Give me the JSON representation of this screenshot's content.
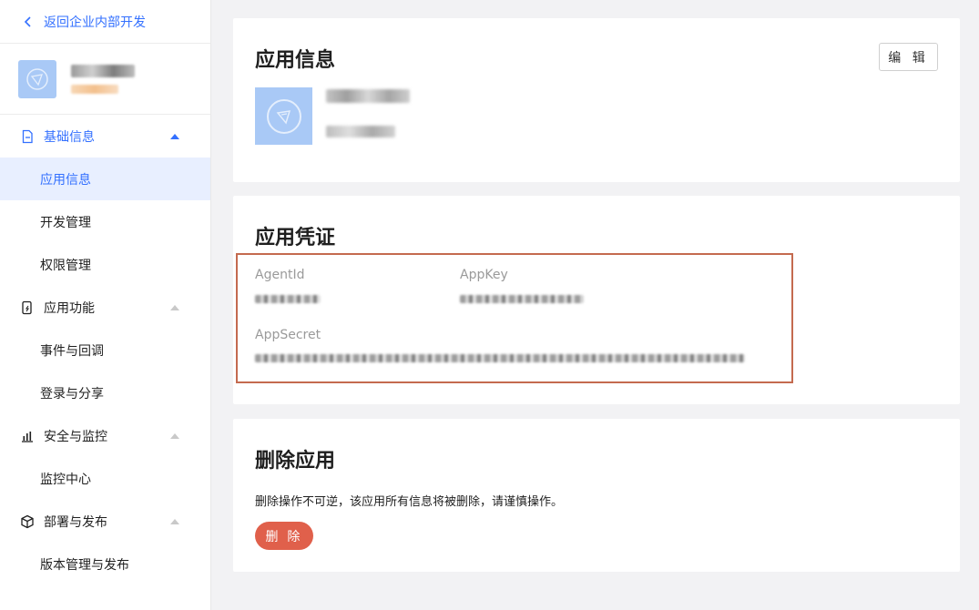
{
  "sidebar": {
    "back_label": "返回企业内部开发",
    "groups": [
      {
        "label": "基础信息",
        "items": [
          "应用信息",
          "开发管理",
          "权限管理"
        ]
      },
      {
        "label": "应用功能",
        "items": [
          "事件与回调",
          "登录与分享"
        ]
      },
      {
        "label": "安全与监控",
        "items": [
          "监控中心"
        ]
      },
      {
        "label": "部署与发布",
        "items": [
          "版本管理与发布"
        ]
      }
    ]
  },
  "info_card": {
    "title": "应用信息",
    "edit_label": "编 辑"
  },
  "cred_card": {
    "title": "应用凭证",
    "agentid_label": "AgentId",
    "appkey_label": "AppKey",
    "appsecret_label": "AppSecret"
  },
  "delete_card": {
    "title": "删除应用",
    "description": "删除操作不可逆，该应用所有信息将被删除，请谨慎操作。",
    "delete_label": "删 除"
  },
  "colors": {
    "accent": "#3370ff",
    "danger": "#e0604b",
    "highlight_border": "#c46a4f",
    "logo_bg": "#a9c9f6"
  }
}
